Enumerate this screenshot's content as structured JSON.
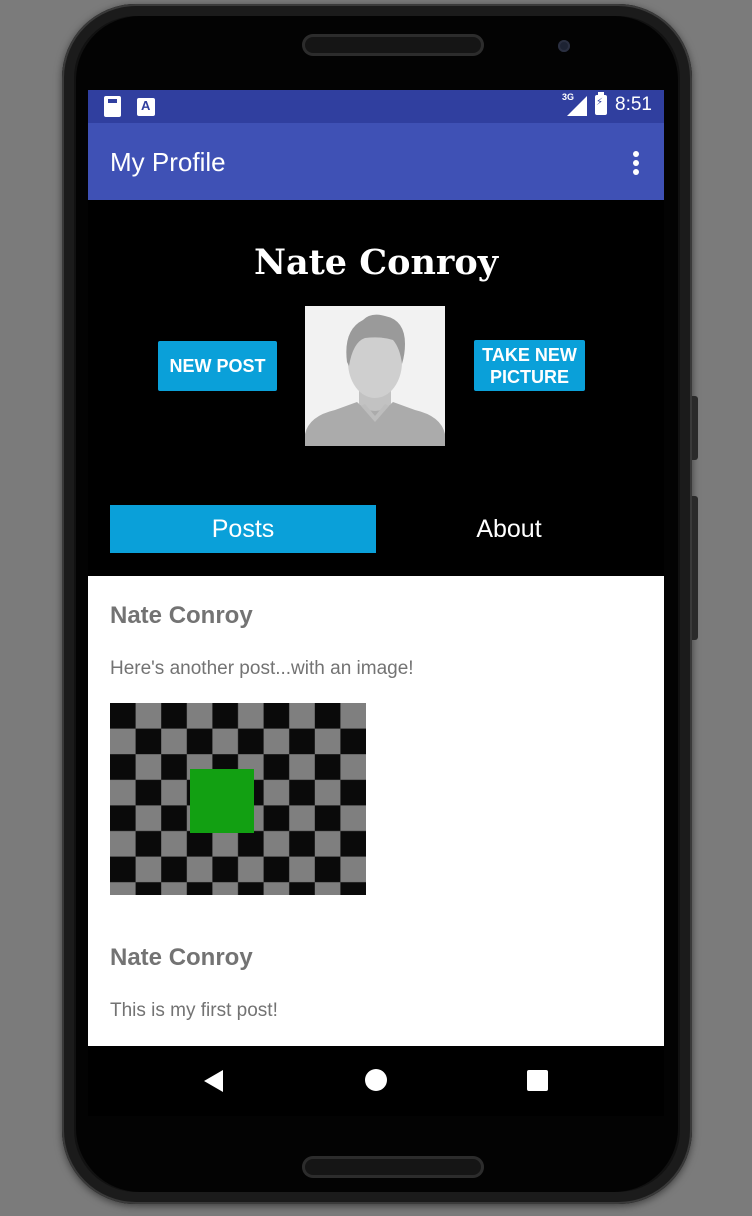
{
  "status_bar": {
    "network": "3G",
    "time": "8:51",
    "icons": [
      "sd-card-icon",
      "font-app-icon",
      "signal-icon",
      "battery-charging-icon"
    ]
  },
  "app_bar": {
    "title": "My Profile",
    "overflow_icon": "more-vert-icon"
  },
  "profile": {
    "name": "Nate Conroy",
    "new_post_label": "NEW POST",
    "take_picture_label_line1": "TAKE NEW",
    "take_picture_label_line2": "PICTURE",
    "avatar_icon": "person-silhouette-icon"
  },
  "tabs": [
    {
      "label": "Posts",
      "selected": true
    },
    {
      "label": "About",
      "selected": false
    }
  ],
  "posts": [
    {
      "author": "Nate Conroy",
      "text": "Here's another post...with an image!",
      "has_image": true
    },
    {
      "author": "Nate Conroy",
      "text": "This is my first post!",
      "has_image": false
    }
  ],
  "nav_bar": {
    "icons": [
      "back-icon",
      "home-icon",
      "recents-icon"
    ]
  },
  "colors": {
    "status_bar": "#303f9f",
    "app_bar": "#3f51b5",
    "accent": "#0aa0d9",
    "post_text": "#737373",
    "image_green": "#12a012",
    "image_gray": "#7f7f7f"
  }
}
